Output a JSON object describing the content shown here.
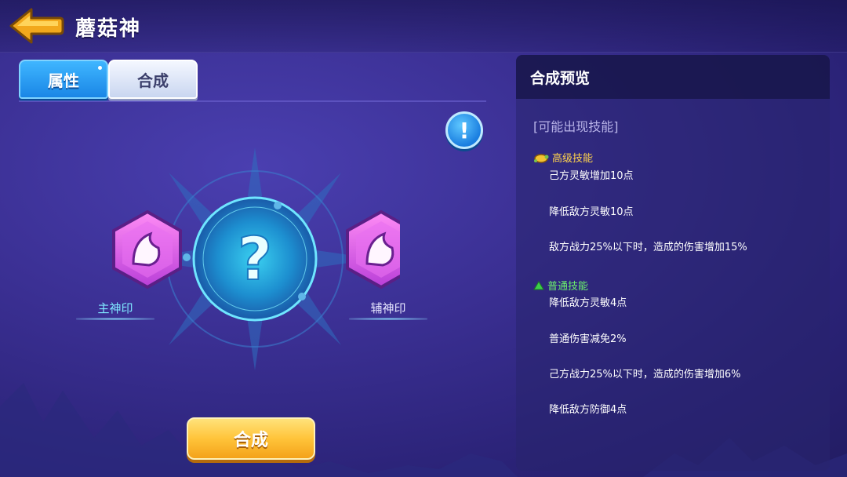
{
  "header": {
    "title": "蘑菇神",
    "back_icon": "back-arrow-icon"
  },
  "tabs": [
    {
      "label": "属性",
      "active": false
    },
    {
      "label": "合成",
      "active": true
    }
  ],
  "info_icon": "exclamation-icon",
  "center": {
    "mystery_icon": "question-mark-icon"
  },
  "seals": {
    "main_label": "主神印",
    "sub_label": "辅神印"
  },
  "synthesize_button": "合成",
  "preview": {
    "title": "合成预览",
    "possible_skills": "[可能出现技能]",
    "advanced": {
      "heading": "高级技能",
      "skills": [
        "己方灵敏增加10点",
        "降低敌方灵敏10点",
        "敌方战力25%以下时，造成的伤害增加15%"
      ]
    },
    "normal": {
      "heading": "普通技能",
      "skills": [
        "降低敌方灵敏4点",
        "普通伤害减免2%",
        "己方战力25%以下时，造成的伤害增加6%",
        "降低敌方防御4点"
      ]
    }
  },
  "colors": {
    "background": "#3a2f92",
    "tab_active": "#e8eefc",
    "tab_inactive": "#2a9cf5",
    "button_gold": "#ffc43a",
    "advanced_heading": "#ffd34d",
    "normal_heading": "#6cf26c"
  }
}
